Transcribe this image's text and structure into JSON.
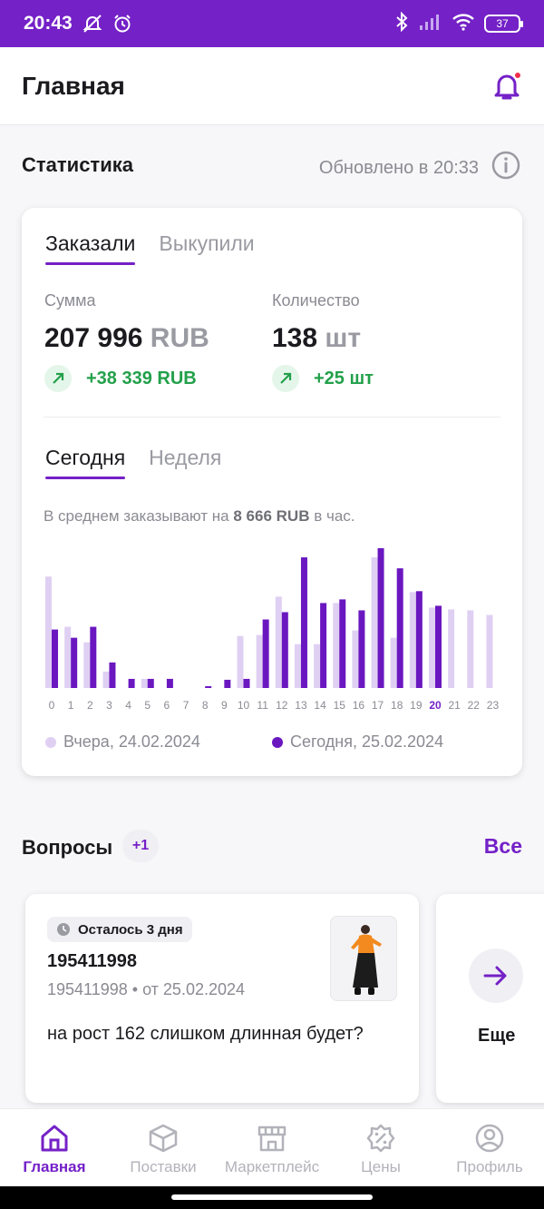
{
  "status_bar": {
    "time": "20:43",
    "battery": "37"
  },
  "header": {
    "title": "Главная"
  },
  "statistics": {
    "title": "Статистика",
    "updated": "Обновлено в 20:33",
    "tabs": [
      {
        "label": "Заказали",
        "active": true
      },
      {
        "label": "Выкупили",
        "active": false
      }
    ],
    "sum": {
      "label": "Сумма",
      "value": "207 996",
      "unit": "RUB",
      "delta": "+38 339 RUB"
    },
    "count": {
      "label": "Количество",
      "value": "138",
      "unit": "шт",
      "delta": "+25 шт"
    },
    "period_tabs": [
      {
        "label": "Сегодня",
        "active": true
      },
      {
        "label": "Неделя",
        "active": false
      }
    ],
    "average": {
      "prefix": "В среднем заказывают на",
      "amount": "8 666 RUB",
      "suffix": "в час."
    },
    "legend": {
      "yesterday": "Вчера, 24.02.2024",
      "today": "Сегодня, 25.02.2024"
    },
    "colors": {
      "accent": "#7421c7",
      "yesterday": "#dfd0f3",
      "today": "#6a17c0"
    }
  },
  "chart_data": {
    "type": "bar",
    "categories": [
      "0",
      "1",
      "2",
      "3",
      "4",
      "5",
      "6",
      "7",
      "8",
      "9",
      "10",
      "11",
      "12",
      "13",
      "14",
      "15",
      "16",
      "17",
      "18",
      "19",
      "20",
      "21",
      "22",
      "23"
    ],
    "current_hour": "20",
    "series": [
      {
        "name": "Вчера, 24.02.2024",
        "values": [
          122,
          67,
          50,
          18,
          0,
          10,
          0,
          0,
          0,
          0,
          57,
          58,
          100,
          48,
          48,
          93,
          63,
          143,
          55,
          105,
          88,
          86,
          85,
          80
        ]
      },
      {
        "name": "Сегодня, 25.02.2024",
        "values": [
          64,
          55,
          67,
          28,
          10,
          10,
          10,
          0,
          1,
          9,
          10,
          75,
          83,
          143,
          93,
          97,
          85,
          153,
          131,
          106,
          90,
          0,
          0,
          0
        ]
      }
    ]
  },
  "questions": {
    "title": "Вопросы",
    "badge": "+1",
    "all_label": "Все",
    "card": {
      "remaining": "Осталось 3 дня",
      "id": "195411998",
      "meta": "195411998 • от 25.02.2024",
      "text": "на рост 162 слишком длинная будет?"
    },
    "more_label": "Еще"
  },
  "nav": [
    {
      "label": "Главная",
      "icon": "home-icon",
      "active": true
    },
    {
      "label": "Поставки",
      "icon": "box-icon",
      "active": false
    },
    {
      "label": "Маркетплейс",
      "icon": "store-icon",
      "active": false
    },
    {
      "label": "Цены",
      "icon": "discount-icon",
      "active": false
    },
    {
      "label": "Профиль",
      "icon": "profile-icon",
      "active": false
    }
  ]
}
